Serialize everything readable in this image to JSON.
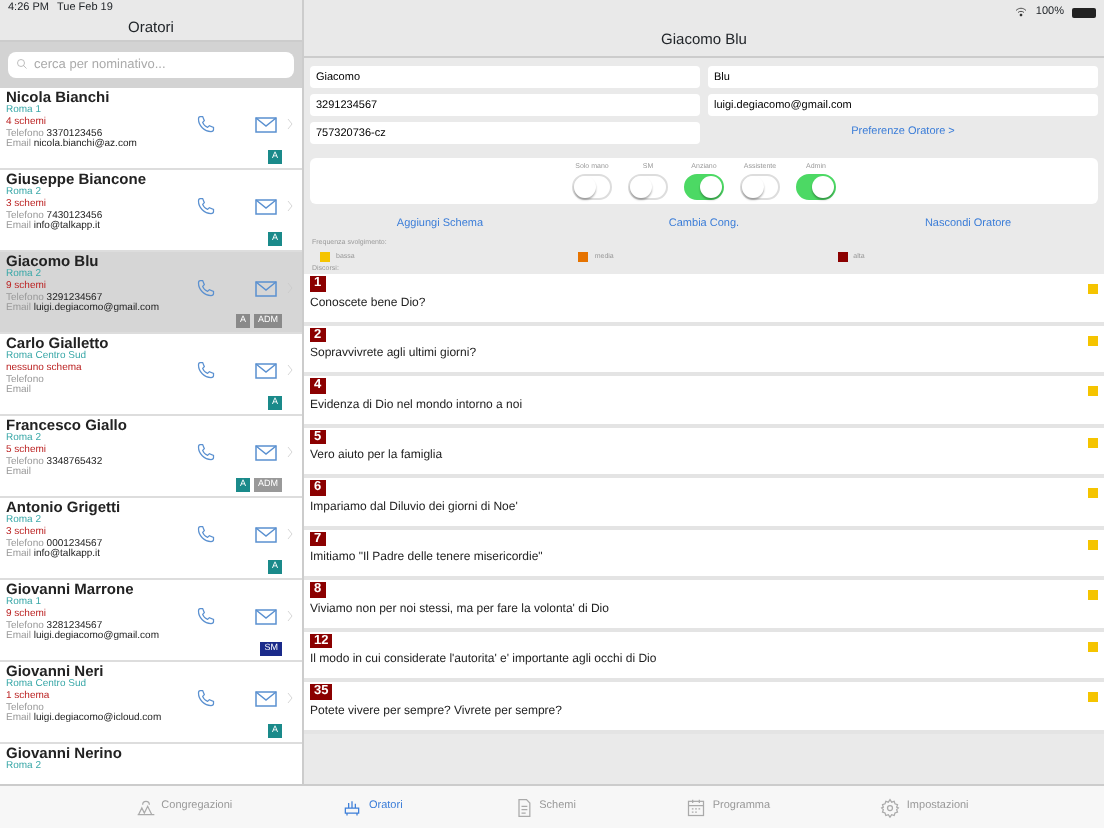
{
  "status_bar": {
    "time": "4:26 PM",
    "date": "Tue Feb 19",
    "battery": "100%"
  },
  "left": {
    "title": "Oratori",
    "search": {
      "placeholder": "cerca per nominativo..."
    },
    "speakers": [
      {
        "name": "Nicola Bianchi",
        "congregation": "Roma 1",
        "schemes": "4 schemi",
        "phone_label": "Telefono",
        "phone": "3370123456",
        "email_label": "Email",
        "email": "nicola.bianchi@az.com",
        "selected": false,
        "badges": [
          {
            "text": "A",
            "kind": "teal"
          }
        ]
      },
      {
        "name": "Giuseppe Biancone",
        "congregation": "Roma 2",
        "schemes": "3 schemi",
        "phone_label": "Telefono",
        "phone": "7430123456",
        "email_label": "Email",
        "email": "info@talkapp.it",
        "selected": false,
        "badges": [
          {
            "text": "A",
            "kind": "teal"
          }
        ]
      },
      {
        "name": "Giacomo Blu",
        "congregation": "Roma 2",
        "schemes": "9 schemi",
        "phone_label": "Telefono",
        "phone": "3291234567",
        "email_label": "Email",
        "email": "luigi.degiacomo@gmail.com",
        "selected": true,
        "badges": [
          {
            "text": "A",
            "kind": "plain"
          },
          {
            "text": "ADM",
            "kind": "plain"
          }
        ]
      },
      {
        "name": "Carlo Gialletto",
        "congregation": "Roma Centro Sud",
        "schemes": "nessuno schema",
        "phone_label": "Telefono",
        "email_label": "Email",
        "selected": false,
        "badges": [
          {
            "text": "A",
            "kind": "teal"
          }
        ]
      },
      {
        "name": "Francesco Giallo",
        "congregation": "Roma 2",
        "schemes": "5 schemi",
        "phone_label": "Telefono",
        "phone": "3348765432",
        "email_label": "Email",
        "selected": false,
        "badges": [
          {
            "text": "A",
            "kind": "teal"
          },
          {
            "text": "ADM",
            "kind": "grey"
          }
        ]
      },
      {
        "name": "Antonio Grigetti",
        "congregation": "Roma 2",
        "schemes": "3 schemi",
        "phone_label": "Telefono",
        "phone": "0001234567",
        "email_label": "Email",
        "email": "info@talkapp.it",
        "selected": false,
        "badges": [
          {
            "text": "A",
            "kind": "teal"
          }
        ]
      },
      {
        "name": "Giovanni Marrone",
        "congregation": "Roma 1",
        "schemes": "9 schemi",
        "phone_label": "Telefono",
        "phone": "3281234567",
        "email_label": "Email",
        "email": "luigi.degiacomo@gmail.com",
        "selected": false,
        "badges": [
          {
            "text": "SM",
            "kind": "navy"
          }
        ]
      },
      {
        "name": "Giovanni Neri",
        "congregation": "Roma Centro Sud",
        "schemes": "1 schema",
        "phone_label": "Telefono",
        "email_label": "Email",
        "email": "luigi.degiacomo@icloud.com",
        "selected": false,
        "badges": [
          {
            "text": "A",
            "kind": "teal"
          }
        ]
      },
      {
        "name": "Giovanni Nerino",
        "congregation": "Roma 2"
      }
    ]
  },
  "detail": {
    "title": "Giacomo Blu",
    "fields": [
      {
        "value": "Giacomo"
      },
      {
        "value": "Blu"
      },
      {
        "value": "3291234567"
      },
      {
        "value": "luigi.degiacomo@gmail.com"
      },
      {
        "value": "757320736-cz"
      }
    ],
    "preferences_link": "Preferenze Oratore >",
    "switches": [
      {
        "label": "Solo mano",
        "on": false
      },
      {
        "label": "SM",
        "on": false
      },
      {
        "label": "Anziano",
        "on": true
      },
      {
        "label": "Assistente",
        "on": false
      },
      {
        "label": "Admin",
        "on": true
      }
    ],
    "actions": [
      "Aggiungi Schema",
      "Cambia Cong.",
      "Nascondi Oratore"
    ],
    "frequency_label": "Frequenza svolgimento:",
    "legend": [
      {
        "label": "bassa",
        "color": "#f5c400"
      },
      {
        "label": "media",
        "color": "#e67300"
      },
      {
        "label": "alta",
        "color": "#8b0000"
      }
    ],
    "talks_label": "Discorsi:",
    "talks": [
      {
        "number": "1",
        "title": "Conoscete bene Dio?",
        "color": "#f5c400"
      },
      {
        "number": "2",
        "title": "Sopravvivrete agli ultimi giorni?",
        "color": "#f5c400"
      },
      {
        "number": "4",
        "title": "Evidenza di Dio nel mondo intorno a noi",
        "color": "#f5c400"
      },
      {
        "number": "5",
        "title": "Vero aiuto per la famiglia",
        "color": "#f5c400"
      },
      {
        "number": "6",
        "title": "Impariamo dal Diluvio dei giorni di Noe'",
        "color": "#f5c400"
      },
      {
        "number": "7",
        "title": "Imitiamo \"Il Padre delle tenere misericordie\"",
        "color": "#f5c400"
      },
      {
        "number": "8",
        "title": "Viviamo non per noi stessi, ma per fare la volonta' di Dio",
        "color": "#f5c400"
      },
      {
        "number": "12",
        "title": "Il modo in cui considerate l'autorita' e' importante agli occhi di Dio",
        "color": "#f5c400"
      },
      {
        "number": "35",
        "title": "Potete vivere per sempre? Vivrete per sempre?",
        "color": "#f5c400"
      }
    ]
  },
  "tabs": [
    {
      "label": "Congregazioni",
      "selected": false
    },
    {
      "label": "Oratori",
      "selected": true
    },
    {
      "label": "Schemi",
      "selected": false
    },
    {
      "label": "Programma",
      "selected": false
    },
    {
      "label": "Impostazioni",
      "selected": false
    }
  ]
}
